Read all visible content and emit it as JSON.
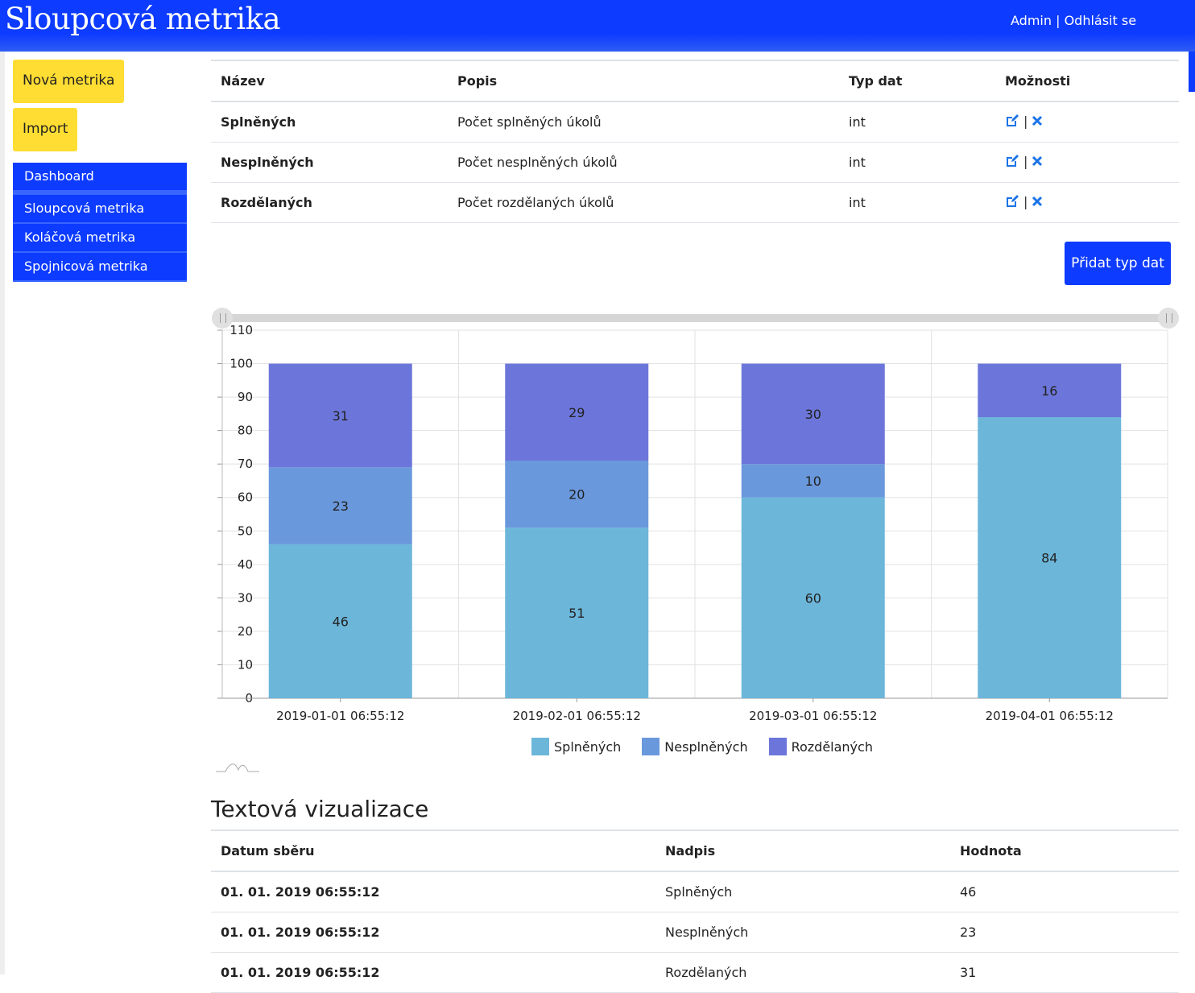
{
  "header": {
    "title": "Sloupcová metrika",
    "user": "Admin",
    "separator": "|",
    "logout": "Odhlásit se"
  },
  "sidebar": {
    "new_metric": "Nová metrika",
    "import": "Import",
    "nav": [
      "Dashboard",
      "Sloupcová metrika",
      "Koláčová metrika",
      "Spojnicová metrika"
    ]
  },
  "types_table": {
    "headers": [
      "Název",
      "Popis",
      "Typ dat",
      "Možnosti"
    ],
    "rows": [
      {
        "name": "Splněných",
        "desc": "Počet splněných úkolů",
        "type": "int"
      },
      {
        "name": "Nesplněných",
        "desc": "Počet nesplněných úkolů",
        "type": "int"
      },
      {
        "name": "Rozdělaných",
        "desc": "Počet rozdělaných úkolů",
        "type": "int"
      }
    ],
    "option_separator": "|"
  },
  "add_type_button": "Přidat typ dat",
  "icons": {
    "edit": "edit-square-icon",
    "delete": "close-x-icon",
    "range_handle": "slider-handle-icon",
    "minimap": "minimap-wave-icon"
  },
  "colors": {
    "accent": "#0d3bff",
    "yellow": "#ffdd33",
    "splnenych": "#6cb6da",
    "nesplnenych": "#6a98dc",
    "rozdelanych": "#6c76da",
    "action": "#1a73e8"
  },
  "chart_data": {
    "type": "bar",
    "stacked": true,
    "categories": [
      "2019-01-01 06:55:12",
      "2019-02-01 06:55:12",
      "2019-03-01 06:55:12",
      "2019-04-01 06:55:12"
    ],
    "series": [
      {
        "name": "Splněných",
        "values": [
          46,
          51,
          60,
          84
        ]
      },
      {
        "name": "Nesplněných",
        "values": [
          23,
          20,
          10,
          0
        ]
      },
      {
        "name": "Rozdělaných",
        "values": [
          31,
          29,
          30,
          16
        ]
      }
    ],
    "yticks": [
      0,
      10,
      20,
      30,
      40,
      50,
      60,
      70,
      80,
      90,
      100,
      110
    ],
    "ylim": [
      0,
      110
    ],
    "grid": true,
    "legend": "bottom-center"
  },
  "text_section": {
    "title": "Textová vizualizace",
    "headers": [
      "Datum sběru",
      "Nadpis",
      "Hodnota"
    ],
    "rows": [
      {
        "date": "01. 01. 2019 06:55:12",
        "label": "Splněných",
        "value": "46"
      },
      {
        "date": "01. 01. 2019 06:55:12",
        "label": "Nesplněných",
        "value": "23"
      },
      {
        "date": "01. 01. 2019 06:55:12",
        "label": "Rozdělaných",
        "value": "31"
      }
    ]
  }
}
